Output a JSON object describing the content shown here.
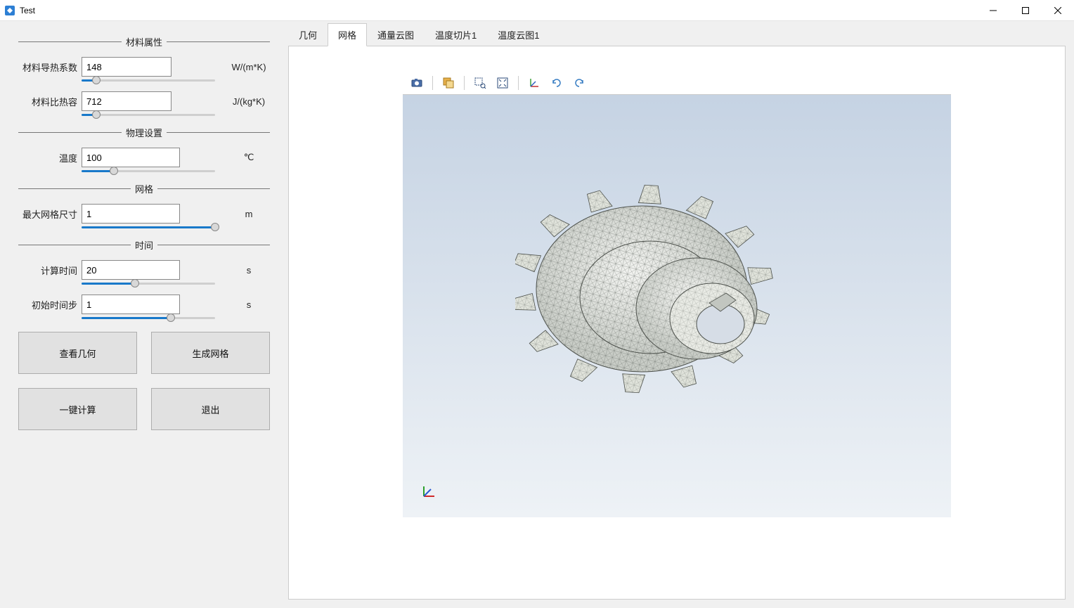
{
  "window": {
    "title": "Test"
  },
  "sidebar": {
    "groups": {
      "material": {
        "title": "材料属性",
        "thermal_conductivity": {
          "label": "材料导热系数",
          "value": "148",
          "unit": "W/(m*K)",
          "slider_pct": 11
        },
        "specific_heat": {
          "label": "材料比热容",
          "value": "712",
          "unit": "J/(kg*K)",
          "slider_pct": 11
        }
      },
      "physics": {
        "title": "物理设置",
        "temperature": {
          "label": "温度",
          "value": "100",
          "unit": "℃",
          "slider_pct": 24
        }
      },
      "mesh": {
        "title": "网格",
        "max_size": {
          "label": "最大网格尺寸",
          "value": "1",
          "unit": "m",
          "slider_pct": 100
        }
      },
      "time": {
        "title": "时间",
        "compute_time": {
          "label": "计算时间",
          "value": "20",
          "unit": "s",
          "slider_pct": 40
        },
        "initial_step": {
          "label": "初始时间步",
          "value": "1",
          "unit": "s",
          "slider_pct": 67
        }
      }
    },
    "buttons": {
      "view_geometry": "查看几何",
      "generate_mesh": "生成网格",
      "compute": "一键计算",
      "exit": "退出"
    }
  },
  "tabs": {
    "items": [
      {
        "label": "几何",
        "active": false
      },
      {
        "label": "网格",
        "active": true
      },
      {
        "label": "通量云图",
        "active": false
      },
      {
        "label": "温度切片1",
        "active": false
      },
      {
        "label": "温度云图1",
        "active": false
      }
    ]
  },
  "toolbar_icons": [
    "camera-icon",
    "layers-icon",
    "zoom-box-icon",
    "fit-view-icon",
    "axes-icon",
    "rotate-ccw-icon",
    "rotate-cw-icon"
  ]
}
